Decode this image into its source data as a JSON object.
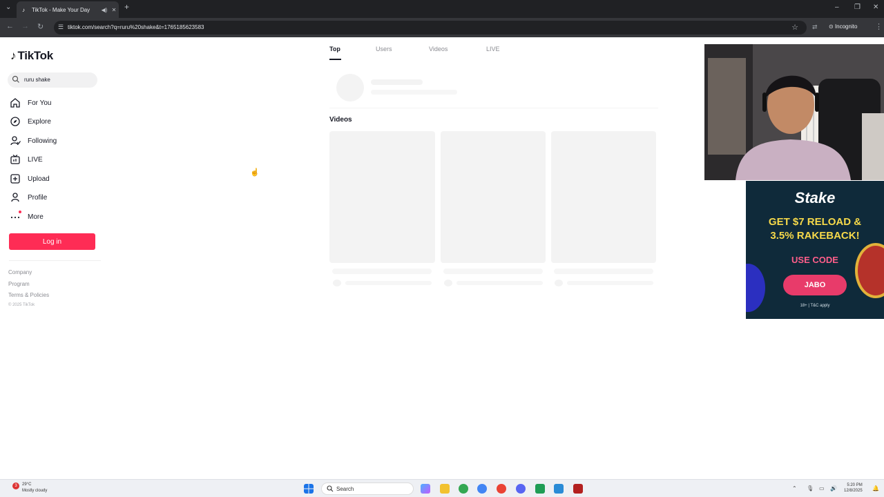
{
  "browser": {
    "tab_title": "TikTok - Make Your Day",
    "url": "tiktok.com/search?q=ruru%20shake&t=1765185623583",
    "mode_label": "Incognito"
  },
  "sidebar": {
    "logo_text": "TikTok",
    "search_value": "ruru shake",
    "items": [
      {
        "label": "For You",
        "icon": "home-icon"
      },
      {
        "label": "Explore",
        "icon": "compass-icon"
      },
      {
        "label": "Following",
        "icon": "following-icon"
      },
      {
        "label": "LIVE",
        "icon": "live-icon"
      },
      {
        "label": "Upload",
        "icon": "upload-icon"
      },
      {
        "label": "Profile",
        "icon": "profile-icon"
      },
      {
        "label": "More",
        "icon": "more-icon"
      }
    ],
    "login_label": "Log in",
    "footer": {
      "company": "Company",
      "program": "Program",
      "terms": "Terms & Policies",
      "copyright": "© 2025 TikTok"
    }
  },
  "main": {
    "tabs": [
      "Top",
      "Users",
      "Videos",
      "LIVE"
    ],
    "active_tab": "Top",
    "videos_heading": "Videos"
  },
  "ad": {
    "brand": "Stake",
    "headline_line1": "GET $7 RELOAD &",
    "headline_line2": "3.5% RAKEBACK!",
    "cta_label": "USE CODE",
    "code": "JABO",
    "terms": "18+ | T&C apply"
  },
  "taskbar": {
    "weather_temp": "29°C",
    "weather_condition": "Mostly cloudy",
    "weather_badge": "3",
    "search_placeholder": "Search",
    "time": "5:20 PM",
    "date": "12/8/2025"
  },
  "colors": {
    "accent": "#fe2c55",
    "browser_dark": "#202124",
    "ad_gold": "#f6d94a"
  }
}
